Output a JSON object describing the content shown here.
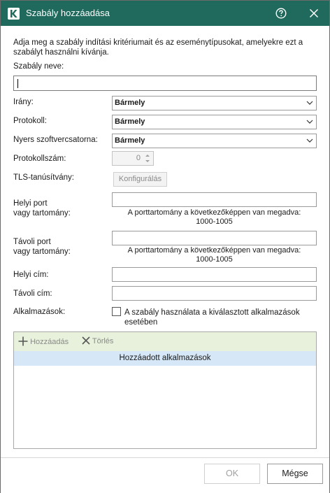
{
  "window": {
    "title": "Szabály hozzáadása",
    "logo_letter": "K",
    "accent_color": "#1f6a5c"
  },
  "form": {
    "intro": "Adja meg a szabály indítási kritériumait és az eseménytípusokat, amelyekre ezt a szabályt használni kívánja.",
    "rule_name_label": "Szabály neve:",
    "rule_name_value": "",
    "direction_label": "Irány:",
    "direction_value": "Bármely",
    "protocol_label": "Protokoll:",
    "protocol_value": "Bármely",
    "raw_socket_label": "Nyers szoftvercsatorna:",
    "raw_socket_value": "Bármely",
    "protocol_number_label": "Protokollszám:",
    "protocol_number_value": "0",
    "tls_label": "TLS-tanúsítvány:",
    "tls_button": "Konfigurálás",
    "local_port_label_1": "Helyi port",
    "local_port_label_2": "vagy tartomány:",
    "local_port_hint_1": "A porttartomány a következőképpen van megadva:",
    "local_port_hint_2": "1000-1005",
    "remote_port_label_1": "Távoli port",
    "remote_port_label_2": "vagy tartomány:",
    "remote_port_hint_1": "A porttartomány a következőképpen van megadva:",
    "remote_port_hint_2": "1000-1005",
    "local_address_label": "Helyi cím:",
    "remote_address_label": "Távoli cím:",
    "applications_label": "Alkalmazások:",
    "applications_checkbox": "A szabály használata a kiválasztott alkalmazások esetében",
    "applications_checked": false
  },
  "app_list": {
    "add_label": "Hozzáadás",
    "delete_label": "Törlés",
    "column_header": "Hozzáadott alkalmazások",
    "rows": []
  },
  "footer": {
    "ok_label": "OK",
    "cancel_label": "Mégse"
  }
}
